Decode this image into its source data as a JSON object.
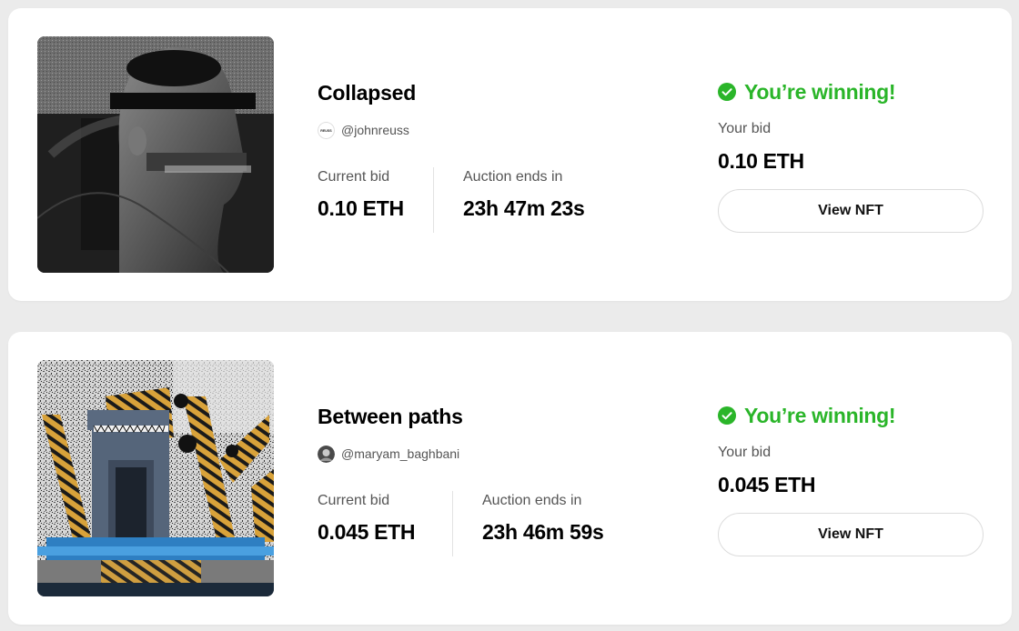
{
  "auctions": [
    {
      "title": "Collapsed",
      "creator_handle": "@johnreuss",
      "creator_avatar_text": "REUSS",
      "current_bid_label": "Current bid",
      "current_bid": "0.10 ETH",
      "auction_ends_label": "Auction ends in",
      "auction_ends": "23h 47m 23s",
      "status": "You’re winning!",
      "your_bid_label": "Your bid",
      "your_bid": "0.10 ETH",
      "view_button": "View NFT"
    },
    {
      "title": "Between paths",
      "creator_handle": "@maryam_baghbani",
      "current_bid_label": "Current bid",
      "current_bid": "0.045 ETH",
      "auction_ends_label": "Auction ends in",
      "auction_ends": "23h 46m 59s",
      "status": "You’re winning!",
      "your_bid_label": "Your bid",
      "your_bid": "0.045 ETH",
      "view_button": "View NFT"
    }
  ],
  "colors": {
    "winning_green": "#2ab529",
    "page_background": "#ebebeb",
    "card_background": "#ffffff"
  },
  "icons": [
    "check-circle-icon"
  ]
}
